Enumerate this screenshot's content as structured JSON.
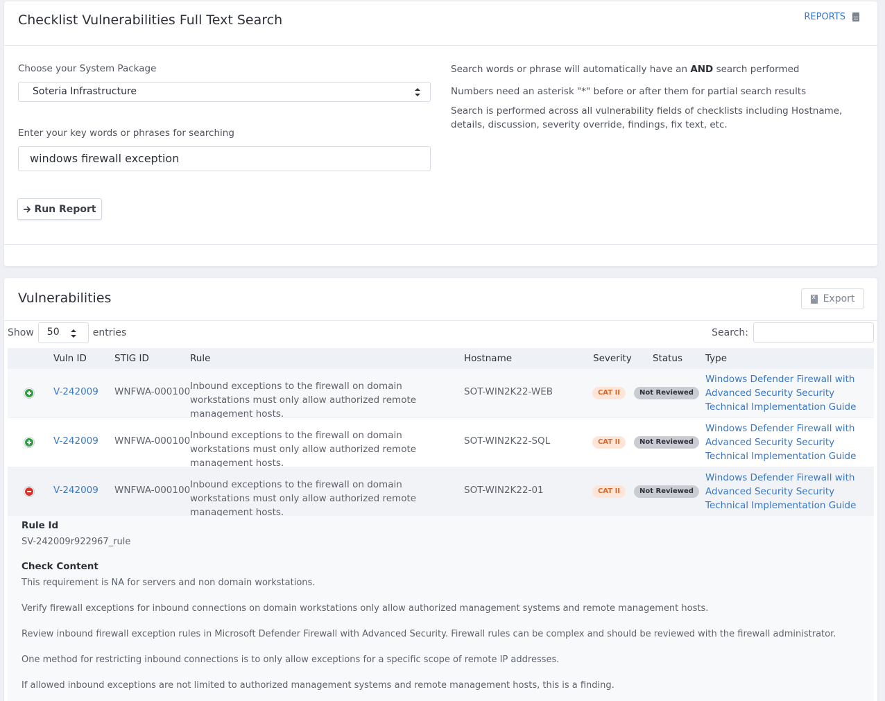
{
  "search_card": {
    "title": "Checklist Vulnerabilities Full Text Search",
    "reports_label": "REPORTS",
    "package_label": "Choose your System Package",
    "package_selected": "Soteria Infrastructure",
    "keywords_label": "Enter your key words or phrases for searching",
    "keywords_value": "windows firewall exception",
    "run_button": "Run Report",
    "help": {
      "line1_pre": "Search words or phrase will automatically have an",
      "line1_bold": "AND",
      "line1_post": "search performed",
      "line2": "Numbers need an asterisk \"*\" before or after them for partial search results",
      "line3": "Search is performed across all vulnerability fields of checklists including Hostname, details, discussion, severity override, findings, fix text, etc."
    }
  },
  "vuln_card": {
    "title": "Vulnerabilities",
    "export_label": "Export",
    "show_label": "Show",
    "entries_value": "50",
    "entries_label": "entries",
    "search_label": "Search:",
    "columns": {
      "vuln_id": "Vuln ID",
      "stig_id": "STIG ID",
      "rule": "Rule",
      "hostname": "Hostname",
      "severity": "Severity",
      "status": "Status",
      "type": "Type"
    },
    "rows": [
      {
        "vuln_id": "V-242009",
        "stig_id": "WNFWA-000100",
        "rule": "Inbound exceptions to the firewall on domain workstations must only allow authorized remote management hosts.",
        "hostname": "SOT-WIN2K22-WEB",
        "severity": "CAT II",
        "status": "Not Reviewed",
        "type": "Windows Defender Firewall with Advanced Security Security Technical Implementation Guide",
        "expanded": false
      },
      {
        "vuln_id": "V-242009",
        "stig_id": "WNFWA-000100",
        "rule": "Inbound exceptions to the firewall on domain workstations must only allow authorized remote management hosts.",
        "hostname": "SOT-WIN2K22-SQL",
        "severity": "CAT II",
        "status": "Not Reviewed",
        "type": "Windows Defender Firewall with Advanced Security Security Technical Implementation Guide",
        "expanded": false
      },
      {
        "vuln_id": "V-242009",
        "stig_id": "WNFWA-000100",
        "rule": "Inbound exceptions to the firewall on domain workstations must only allow authorized remote management hosts.",
        "hostname": "SOT-WIN2K22-01",
        "severity": "CAT II",
        "status": "Not Reviewed",
        "type": "Windows Defender Firewall with Advanced Security Security Technical Implementation Guide",
        "expanded": true
      }
    ],
    "details": {
      "rule_id_label": "Rule Id",
      "rule_id": "SV-242009r922967_rule",
      "check_label": "Check Content",
      "check_lines": [
        "This requirement is NA for servers and non domain workstations.",
        "Verify firewall exceptions for inbound connections on domain workstations only allow authorized management systems and remote management hosts.",
        "Review inbound firewall exception rules in Microsoft Defender Firewall with Advanced Security. Firewall rules can be complex and should be reviewed with the firewall administrator.",
        "One method for restricting inbound connections is to only allow exceptions for a specific scope of remote IP addresses.",
        "If allowed inbound exceptions are not limited to authorized management systems and remote management hosts, this is a finding."
      ]
    }
  }
}
